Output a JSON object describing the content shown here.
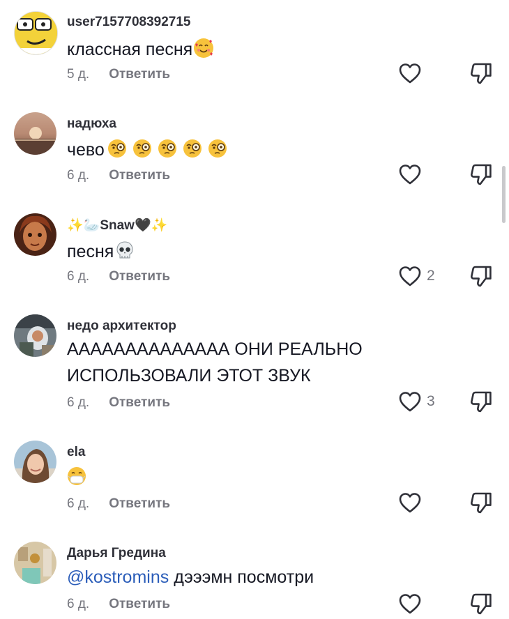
{
  "comments": [
    {
      "username": "user7157708392715",
      "text": "классная песня",
      "time": "5 д.",
      "reply": "Ответить",
      "likes": "",
      "avatar_icon": "cartoon-face-avatar",
      "text_emoji": [
        "smiling-face-with-hearts"
      ]
    },
    {
      "username": "надюха",
      "text": "чево",
      "time": "6 д.",
      "reply": "Ответить",
      "likes": "",
      "avatar_icon": "sunset-photo-avatar",
      "text_emoji": [
        "face-with-monocle",
        "face-with-monocle",
        "face-with-monocle",
        "face-with-monocle",
        "face-with-monocle"
      ]
    },
    {
      "username_prefix": "✨🦢",
      "username": "Snaw",
      "username_suffix": "🖤✨",
      "text": "песня",
      "time": "6 д.",
      "reply": "Ответить",
      "likes": "2",
      "avatar_icon": "doll-photo-avatar",
      "text_emoji": [
        "skull"
      ]
    },
    {
      "username": "недо архитектор",
      "text_line1": "АААААААААААААА ОНИ РЕАЛЬНО",
      "text_line2": "ИСПОЛЬЗОВАЛИ ЭТОТ ЗВУК",
      "time": "6 д.",
      "reply": "Ответить",
      "likes": "3",
      "avatar_icon": "astronaut-photo-avatar"
    },
    {
      "username": "ela",
      "text": "",
      "time": "6 д.",
      "reply": "Ответить",
      "likes": "",
      "avatar_icon": "girl-photo-avatar",
      "text_emoji": [
        "face-with-medical-mask"
      ]
    },
    {
      "username": "Дарья Гредина",
      "mention": "@kostromins",
      "text": " дэээмн посмотри",
      "time": "6 д.",
      "reply": "Ответить",
      "likes": "",
      "avatar_icon": "room-photo-avatar"
    }
  ],
  "colors": {
    "username": "#2f3038",
    "text": "#161823",
    "meta": "#75767e",
    "mention": "#2b5db9"
  }
}
